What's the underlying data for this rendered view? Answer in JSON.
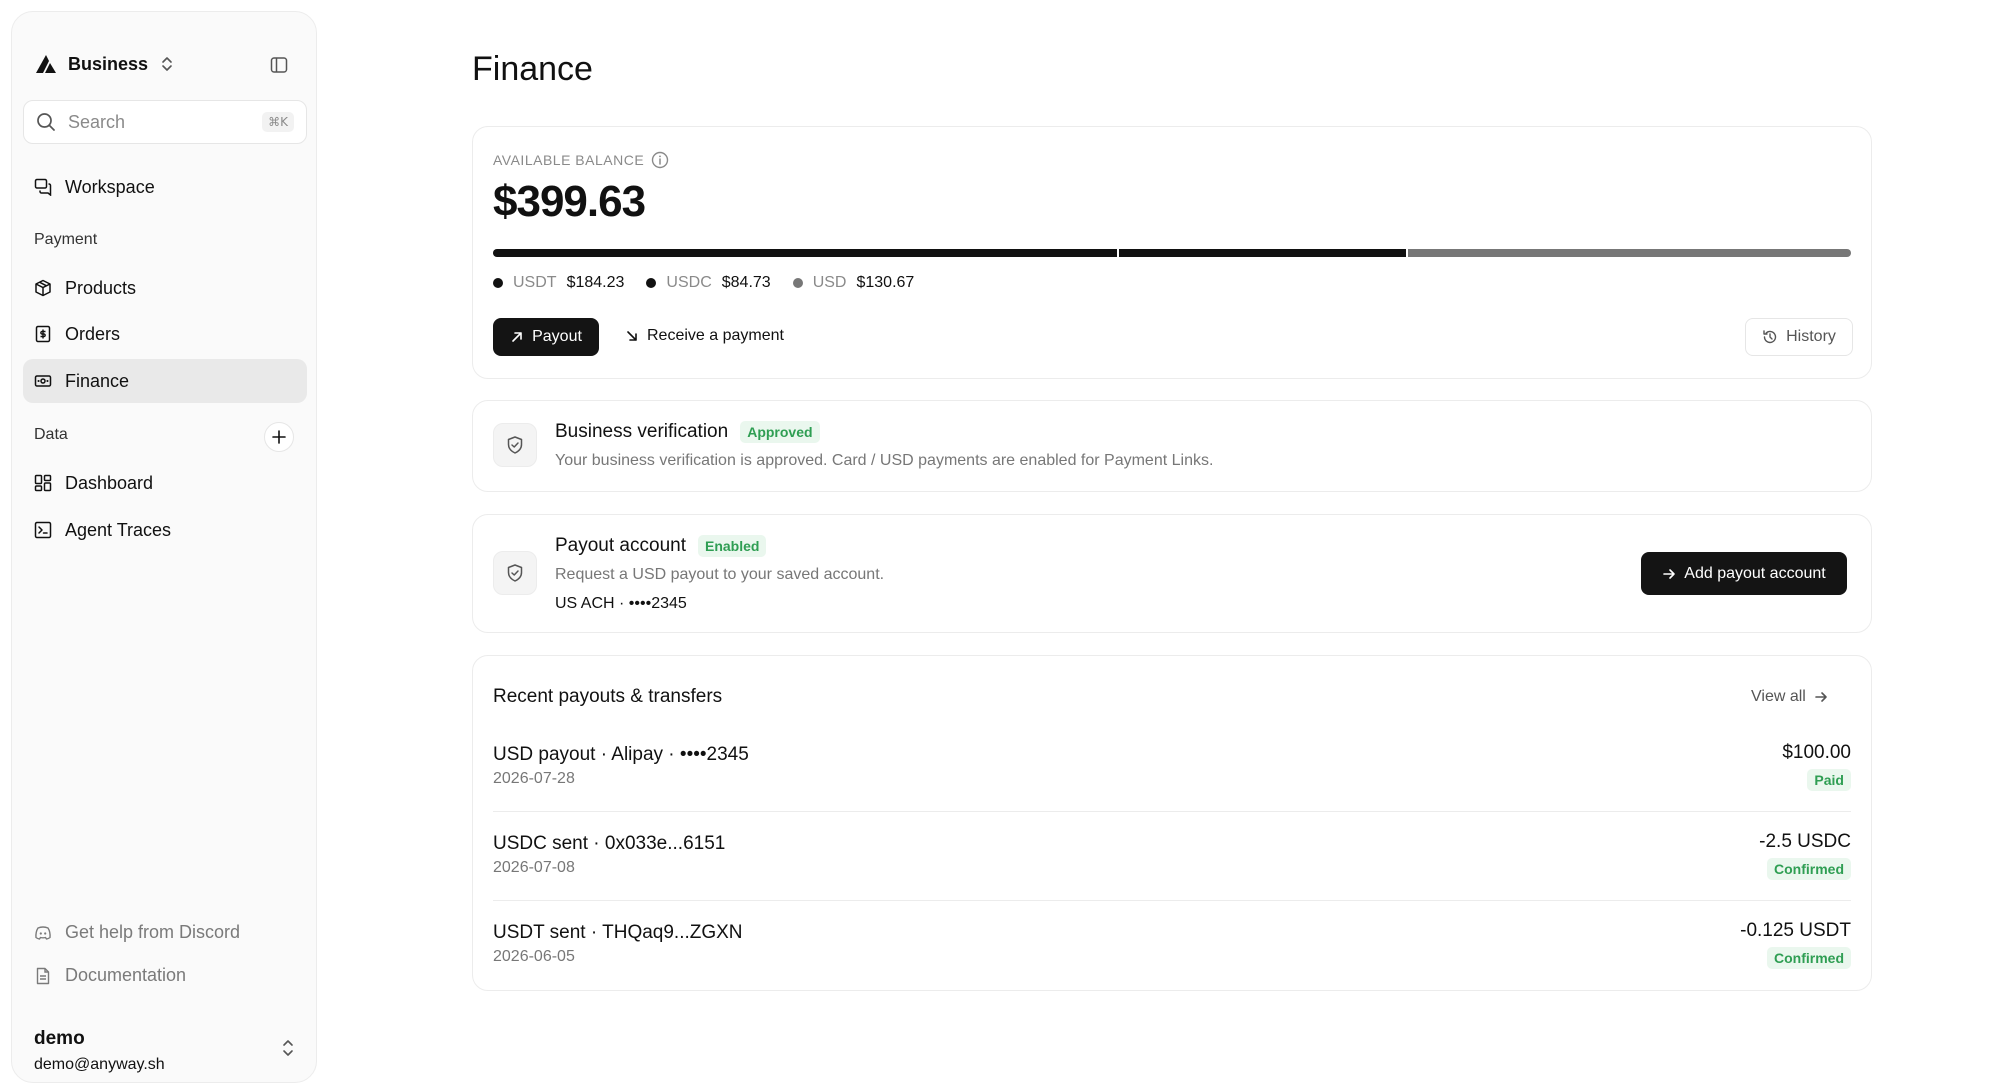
{
  "colors": {
    "accent_dark": "#141414",
    "success_text": "#2f9e53",
    "success_bg": "#eaf7ee",
    "active_nav_bg": "#e9e9e9"
  },
  "sidebar": {
    "workspace_name": "Business",
    "search": {
      "placeholder": "Search",
      "shortcut": "⌘K"
    },
    "top_items": [
      {
        "label": "Workspace",
        "icon": "chat-bubbles-icon"
      }
    ],
    "sections": [
      {
        "label": "Payment",
        "items": [
          {
            "label": "Products",
            "icon": "package-icon"
          },
          {
            "label": "Orders",
            "icon": "receipt-icon"
          },
          {
            "label": "Finance",
            "icon": "banknote-icon",
            "active": true
          }
        ]
      },
      {
        "label": "Data",
        "items": [
          {
            "label": "Dashboard",
            "icon": "dashboard-icon"
          },
          {
            "label": "Agent Traces",
            "icon": "terminal-icon"
          }
        ]
      }
    ],
    "footer_links": [
      {
        "label": "Get help from Discord",
        "icon": "discord-icon"
      },
      {
        "label": "Documentation",
        "icon": "document-icon"
      }
    ],
    "user": {
      "name": "demo",
      "email": "demo@anyway.sh"
    }
  },
  "main": {
    "title": "Finance",
    "balance": {
      "label": "AVAILABLE BALANCE",
      "amount": "$399.63",
      "breakdown": [
        {
          "currency": "USDT",
          "value": "$184.23",
          "amount": 184.23,
          "color": "#111111"
        },
        {
          "currency": "USDC",
          "value": "$84.73",
          "amount": 84.73,
          "color": "#111111"
        },
        {
          "currency": "USD",
          "value": "$130.67",
          "amount": 130.67,
          "color": "#777777"
        }
      ],
      "payout_label": "Payout",
      "receive_label": "Receive a payment",
      "history_label": "History"
    },
    "verification": {
      "title": "Business verification",
      "badge": "Approved",
      "description": "Your business verification is approved. Card / USD payments are enabled for Payment Links."
    },
    "payout_account": {
      "title": "Payout account",
      "badge": "Enabled",
      "description": "Request a USD payout to your saved account.",
      "account": "US ACH · ••••2345",
      "button_label": "Add payout account"
    },
    "recent": {
      "title": "Recent payouts & transfers",
      "view_all": "View all",
      "rows": [
        {
          "title": "USD payout · Alipay · ••••2345",
          "date": "2026-07-28",
          "amount": "$100.00",
          "status": "Paid"
        },
        {
          "title": "USDC sent · 0x033e...6151",
          "date": "2026-07-08",
          "amount": "-2.5 USDC",
          "status": "Confirmed"
        },
        {
          "title": "USDT sent · THQaq9...ZGXN",
          "date": "2026-06-05",
          "amount": "-0.125 USDT",
          "status": "Confirmed"
        }
      ]
    }
  }
}
